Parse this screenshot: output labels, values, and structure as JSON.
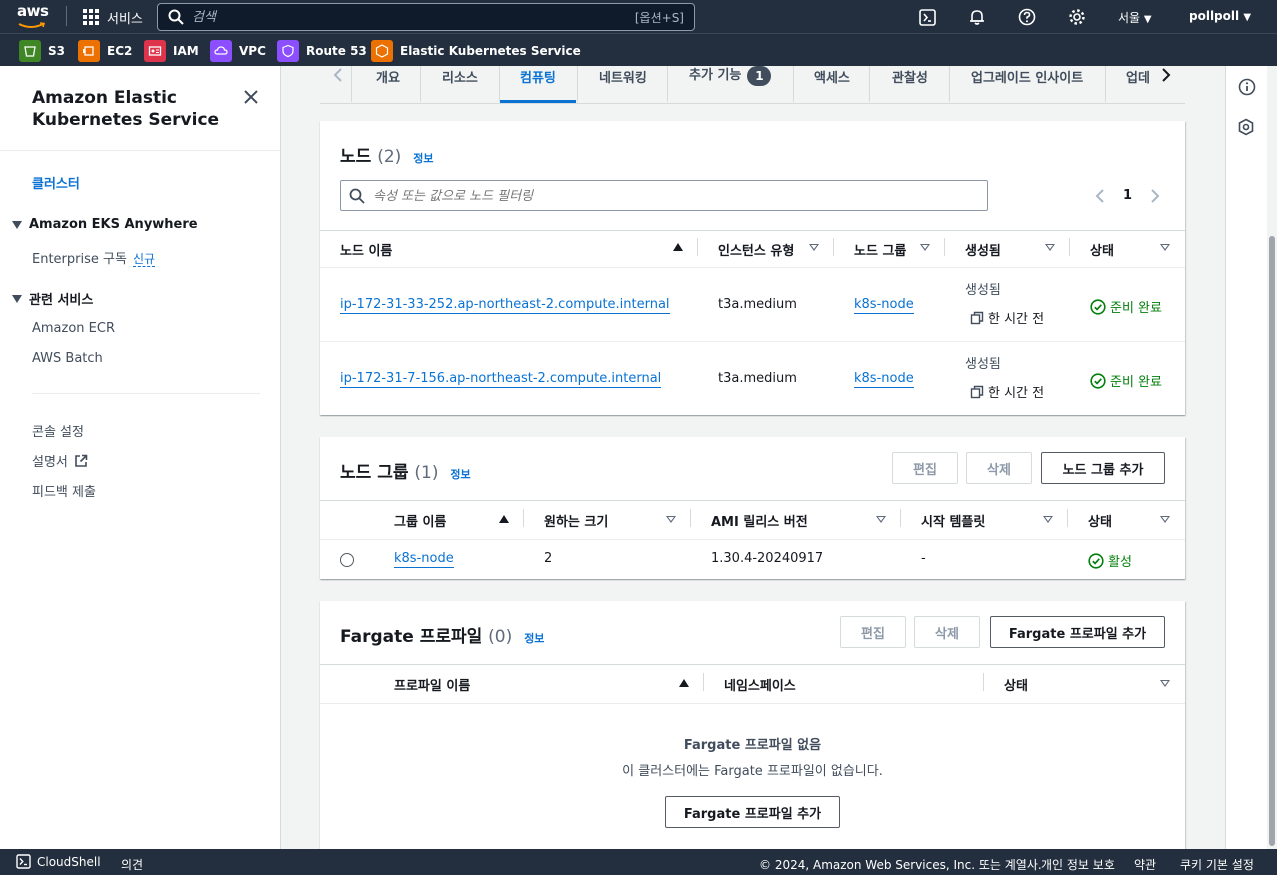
{
  "topnav": {
    "logo_text": "aws",
    "services_label": "서비스",
    "search_placeholder": "검색",
    "search_shortcut": "[옵션+S]",
    "region": "서울",
    "user": "pollpoll"
  },
  "favorites": [
    {
      "label": "S3",
      "color": "#3f8624"
    },
    {
      "label": "EC2",
      "color": "#ed7100"
    },
    {
      "label": "IAM",
      "color": "#dd344c"
    },
    {
      "label": "VPC",
      "color": "#8c4fff"
    },
    {
      "label": "Route 53",
      "color": "#8c4fff"
    },
    {
      "label": "Elastic Kubernetes Service",
      "color": "#ed7100"
    }
  ],
  "sidebar": {
    "title": "Amazon Elastic Kubernetes Service",
    "active_link": "클러스터",
    "sections": [
      {
        "label": "Amazon EKS Anywhere",
        "items": [
          {
            "label": "Enterprise 구독",
            "badge": "신규"
          }
        ]
      },
      {
        "label": "관련 서비스",
        "items": [
          {
            "label": "Amazon ECR"
          },
          {
            "label": "AWS Batch"
          }
        ]
      }
    ],
    "bottom_links": [
      "콘솔 설정",
      "설명서",
      "피드백 제출"
    ]
  },
  "tabs": [
    {
      "label": "개요"
    },
    {
      "label": "리소스"
    },
    {
      "label": "컴퓨팅",
      "active": true
    },
    {
      "label": "네트워킹"
    },
    {
      "label": "추가 기능",
      "count": "1"
    },
    {
      "label": "액세스"
    },
    {
      "label": "관찰성"
    },
    {
      "label": "업그레이드 인사이트"
    },
    {
      "label": "업데"
    }
  ],
  "nodes": {
    "title": "노드",
    "count": "(2)",
    "info": "정보",
    "filter_placeholder": "속성 또는 값으로 노드 필터링",
    "page": "1",
    "columns": [
      "노드 이름",
      "인스턴스 유형",
      "노드 그룹",
      "생성됨",
      "상태"
    ],
    "rows": [
      {
        "name": "ip-172-31-33-252.ap-northeast-2.compute.internal",
        "type": "t3a.medium",
        "group": "k8s-node",
        "created_label": "생성됨",
        "created": "한 시간 전",
        "status": "준비 완료"
      },
      {
        "name": "ip-172-31-7-156.ap-northeast-2.compute.internal",
        "type": "t3a.medium",
        "group": "k8s-node",
        "created_label": "생성됨",
        "created": "한 시간 전",
        "status": "준비 완료"
      }
    ]
  },
  "nodegroups": {
    "title": "노드 그룹",
    "count": "(1)",
    "info": "정보",
    "edit": "편집",
    "delete": "삭제",
    "add": "노드 그룹 추가",
    "columns": [
      "그룹 이름",
      "원하는 크기",
      "AMI 릴리스 버전",
      "시작 템플릿",
      "상태"
    ],
    "rows": [
      {
        "name": "k8s-node",
        "desired": "2",
        "ami": "1.30.4-20240917",
        "template": "-",
        "status": "활성"
      }
    ]
  },
  "fargate": {
    "title": "Fargate 프로파일",
    "count": "(0)",
    "info": "정보",
    "edit": "편집",
    "delete": "삭제",
    "add": "Fargate 프로파일 추가",
    "columns": [
      "프로파일 이름",
      "네임스페이스",
      "상태"
    ],
    "empty_title": "Fargate 프로파일 없음",
    "empty_desc": "이 클러스터에는 Fargate 프로파일이 없습니다.",
    "empty_button": "Fargate 프로파일 추가"
  },
  "footer": {
    "cloudshell": "CloudShell",
    "feedback": "의견",
    "copyright": "© 2024, Amazon Web Services, Inc. 또는 계열사.",
    "privacy": "개인 정보 보호",
    "terms": "약관",
    "cookies": "쿠키 기본 설정"
  }
}
